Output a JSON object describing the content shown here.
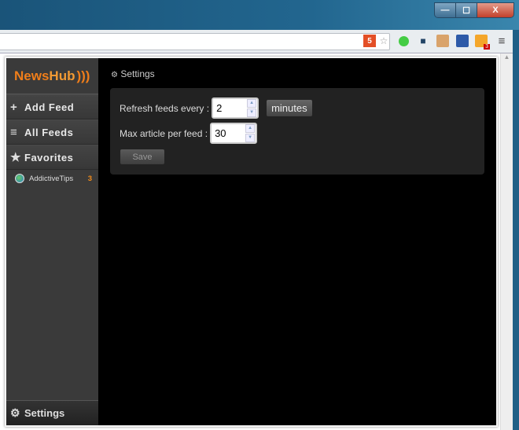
{
  "window": {
    "minimize": "—",
    "maximize": "☐",
    "close": "X"
  },
  "toolbar": {
    "extension_badge": "3",
    "menu": "≡"
  },
  "app": {
    "logo_news": "News",
    "logo_hub": "Hub",
    "nav": [
      {
        "label": "Add Feed",
        "icon": "plus-icon",
        "glyph": "+"
      },
      {
        "label": "All Feeds",
        "icon": "list-icon",
        "glyph": "≡"
      },
      {
        "label": "Favorites",
        "icon": "star-icon",
        "glyph": "★"
      }
    ],
    "feeds": [
      {
        "name": "AddictiveTips",
        "count": "3"
      }
    ],
    "settings_nav": "Settings",
    "settings": {
      "title": "Settings",
      "refresh_label": "Refresh feeds every :",
      "refresh_value": "2",
      "unit": "minutes",
      "max_label": "Max article per feed :",
      "max_value": "30",
      "save": "Save"
    }
  }
}
